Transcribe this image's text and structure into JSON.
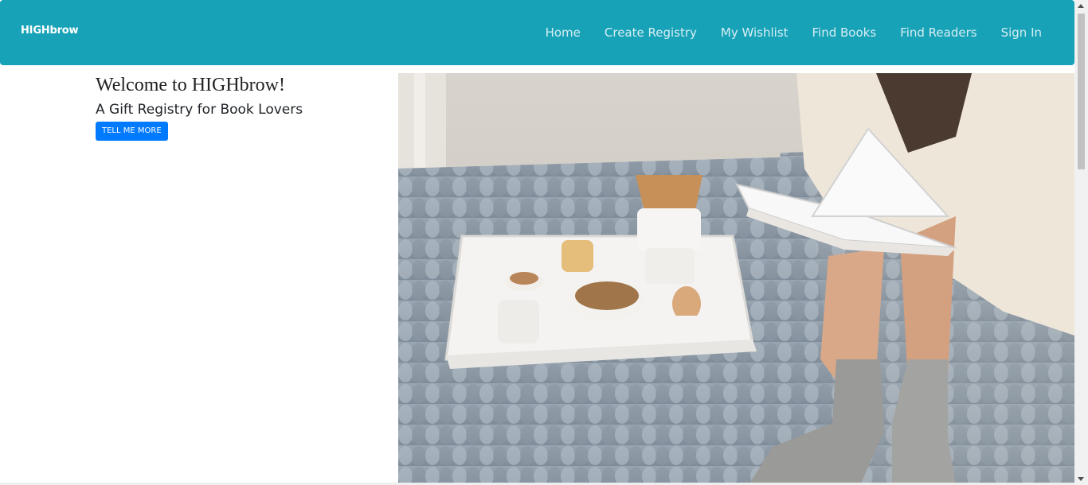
{
  "navbar": {
    "brand": "HIGHbrow",
    "links": [
      {
        "label": "Home"
      },
      {
        "label": "Create Registry"
      },
      {
        "label": "My Wishlist"
      },
      {
        "label": "Find Books"
      },
      {
        "label": "Find Readers"
      },
      {
        "label": "Sign In"
      }
    ],
    "background_color": "#17a2b8"
  },
  "hero": {
    "title": "Welcome to HIGHbrow!",
    "subtitle": "A Gift Registry for Book Lovers",
    "button_label": "TELL ME MORE",
    "button_color": "#007bff"
  }
}
